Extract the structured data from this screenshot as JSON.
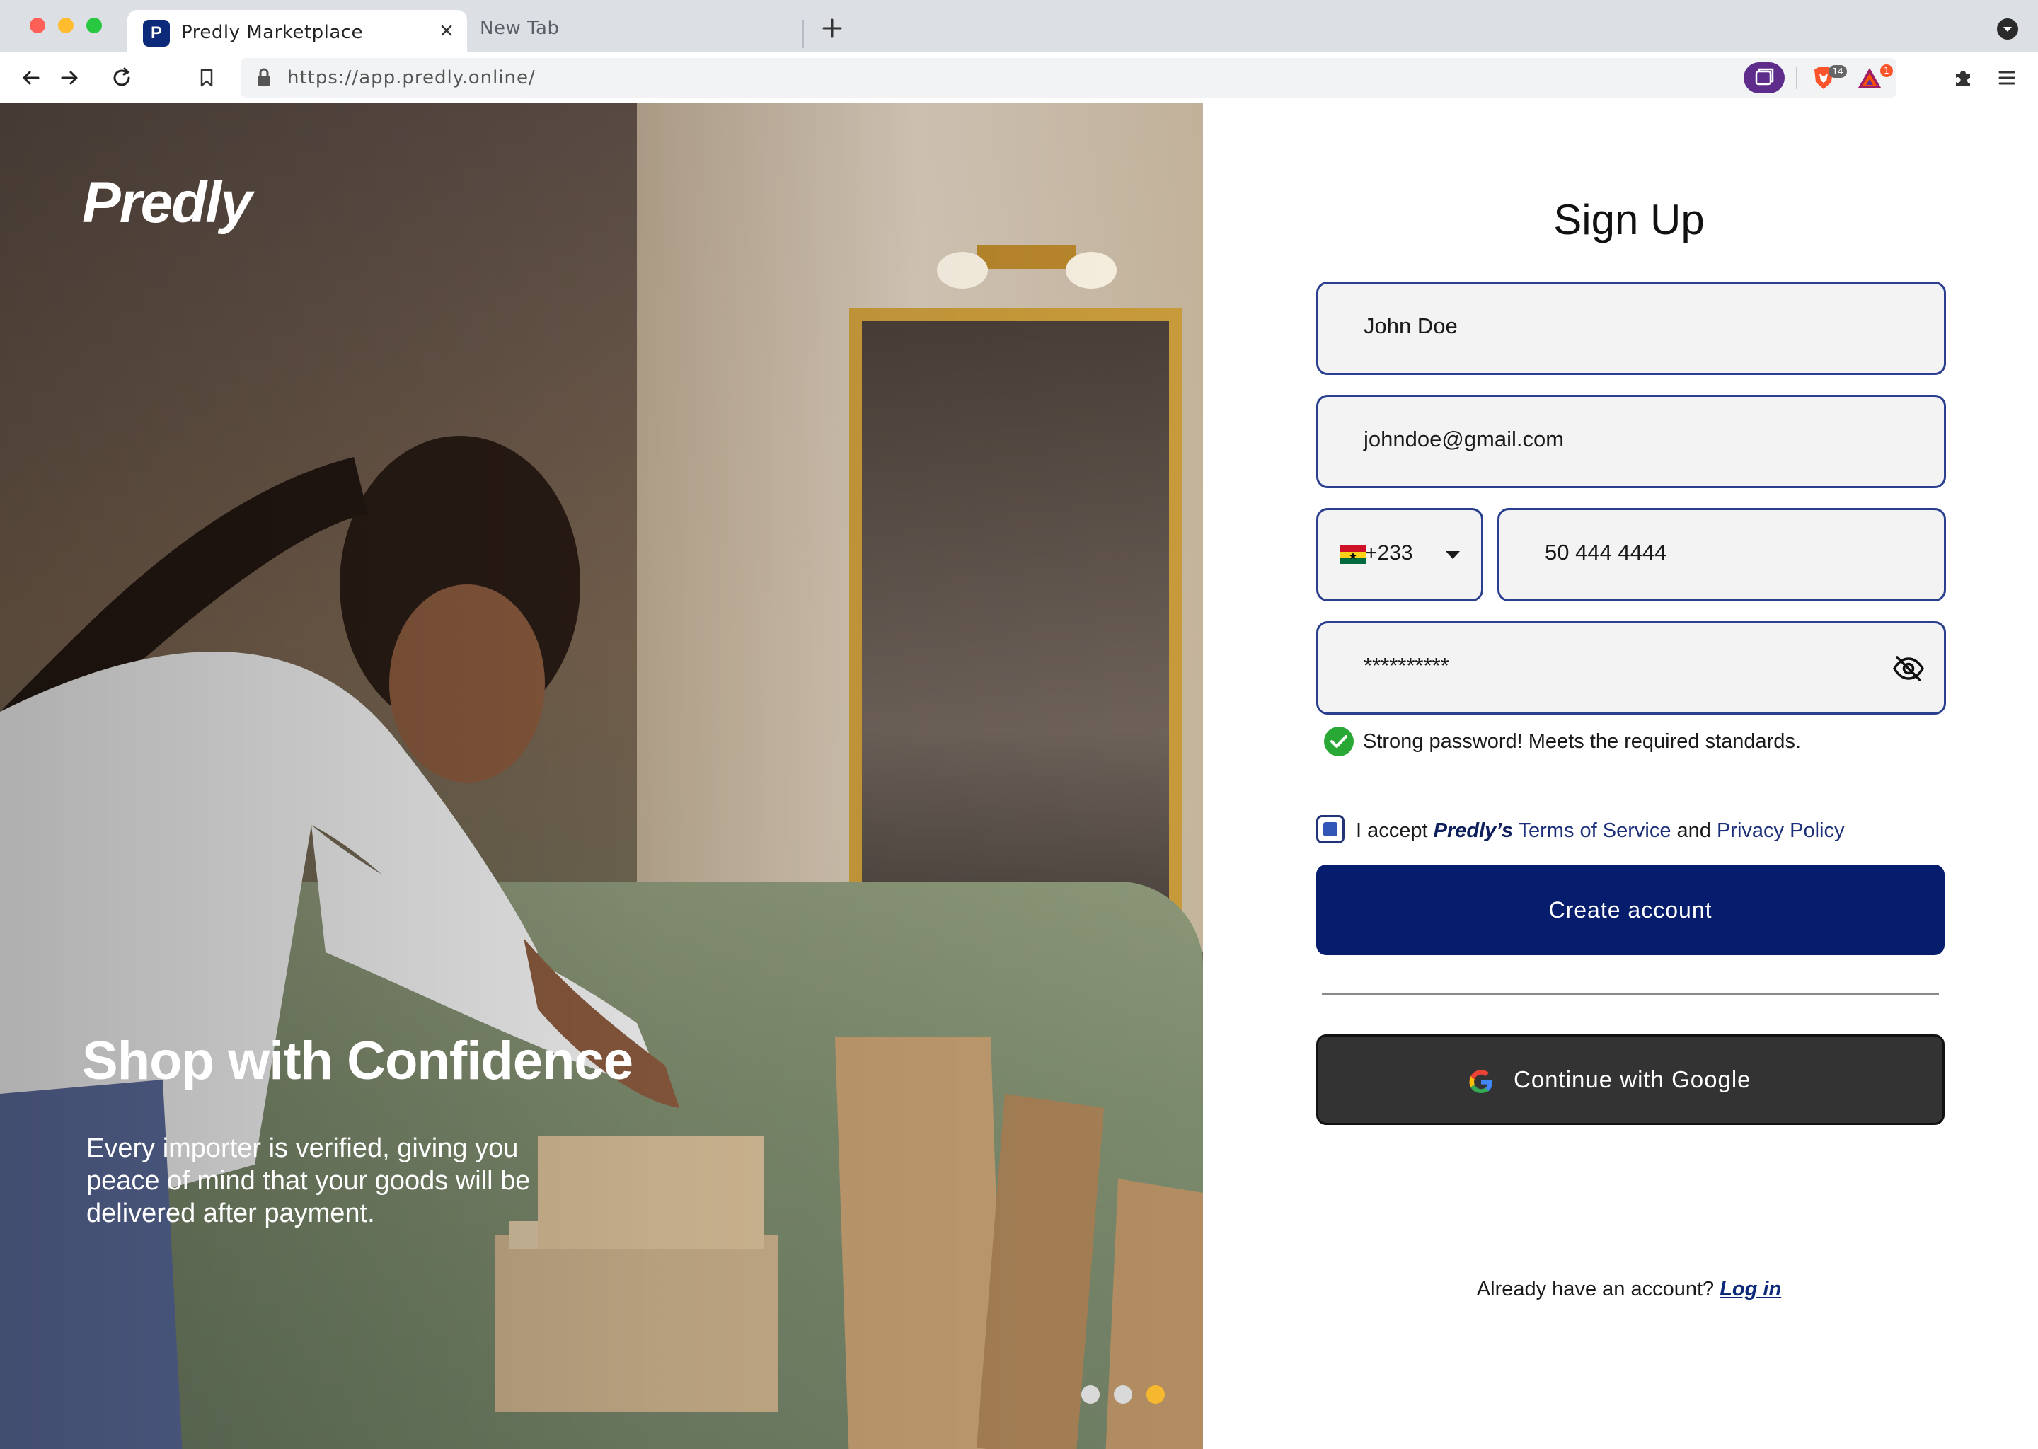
{
  "browser": {
    "tabs": [
      {
        "title": "Predly Marketplace",
        "favicon": "P",
        "active": true
      },
      {
        "title": "New Tab",
        "active": false
      }
    ],
    "url": "https://app.predly.online/",
    "icons": [
      "back-icon",
      "forward-icon",
      "reload-icon",
      "bookmark-icon",
      "lock-icon",
      "tab-overview-icon",
      "brave-shield-icon",
      "brave-rewards-icon",
      "extensions-icon",
      "menu-icon"
    ],
    "brave_shield_count": "14",
    "rewards_badge": "1"
  },
  "hero": {
    "logo": "Predly",
    "headline": "Shop with Confidence",
    "body": "Every importer is verified, giving you peace of mind that your goods will be delivered after payment.",
    "carousel": {
      "count": 3,
      "active_index": 2
    },
    "colors": {
      "active_dot": "#f5b82e",
      "inactive_dot": "#d9d9d9"
    }
  },
  "form": {
    "title": "Sign Up",
    "name_value": "John Doe",
    "email_value": "johndoe@gmail.com",
    "country_code": "+233",
    "country_flag": "ghana-flag",
    "phone_value": "50 444 4444",
    "password_value": "**********",
    "password_strength_message": "Strong password! Meets the required standards.",
    "terms": {
      "prefix": "I accept",
      "brand": "Predly’s",
      "terms_link": "Terms of Service",
      "joiner": "and",
      "privacy_link": "Privacy Policy",
      "checked": true
    },
    "create_button": "Create account",
    "google_button": "Continue with Google",
    "login_prompt": "Already have an account?",
    "login_link": "Log in",
    "colors": {
      "primary": "#061c6c",
      "field_border": "#2b3f8f",
      "success": "#2aa835",
      "google_button_bg": "#333333"
    }
  }
}
